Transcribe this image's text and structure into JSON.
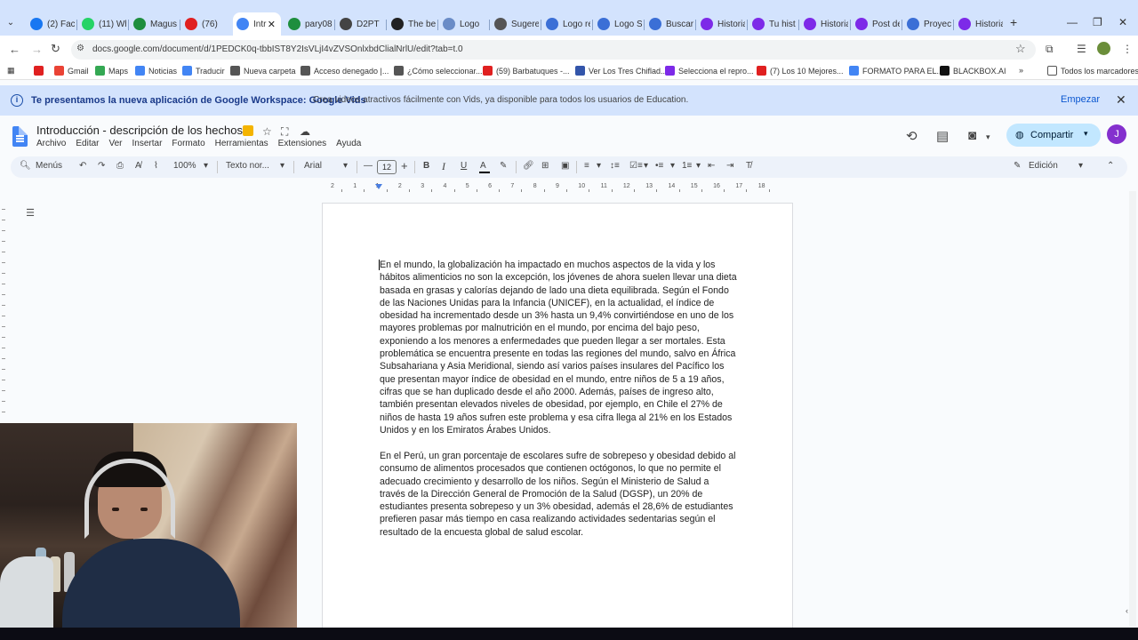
{
  "browser": {
    "tabs": [
      {
        "label": "(2) Face",
        "color": "#1877f2"
      },
      {
        "label": "(11) Wh",
        "color": "#25d366"
      },
      {
        "label": "Magus",
        "color": "#1e8e3e"
      },
      {
        "label": "(76)",
        "color": "#e02020"
      },
      {
        "label": "Intr",
        "color": "#4285f4",
        "active": true
      },
      {
        "label": "pary08",
        "color": "#1e8e3e"
      },
      {
        "label": "D2PT",
        "color": "#444444"
      },
      {
        "label": "The be",
        "color": "#222222"
      },
      {
        "label": "Logo",
        "color": "#6a8cc7"
      },
      {
        "label": "Sugere",
        "color": "#555555"
      },
      {
        "label": "Logo re",
        "color": "#3b6fd6"
      },
      {
        "label": "Logo S",
        "color": "#3b6fd6"
      },
      {
        "label": "Buscar",
        "color": "#3b6fd6"
      },
      {
        "label": "Historia",
        "color": "#7d2ae8"
      },
      {
        "label": "Tu hist",
        "color": "#7d2ae8"
      },
      {
        "label": "Historia",
        "color": "#7d2ae8"
      },
      {
        "label": "Post de",
        "color": "#7d2ae8"
      },
      {
        "label": "Proyect",
        "color": "#3b6fd6"
      },
      {
        "label": "Historia",
        "color": "#7d2ae8"
      }
    ],
    "url": "docs.google.com/document/d/1PEDCK0q-tbbIST8Y2IsVLjI4vZVSOnlxbdClialNrlU/edit?tab=t.0",
    "bookmarks": [
      {
        "label": "Gmail",
        "color": "#ea4335"
      },
      {
        "label": "Maps",
        "color": "#34a853"
      },
      {
        "label": "Noticias",
        "color": "#4285f4"
      },
      {
        "label": "Traducir",
        "color": "#4285f4"
      },
      {
        "label": "Nueva carpeta",
        "color": "#555555"
      },
      {
        "label": "Acceso denegado |...",
        "color": "#555555"
      },
      {
        "label": "¿Cómo seleccionar...",
        "color": "#555555"
      },
      {
        "label": "(59) Barbatuques -...",
        "color": "#e02020"
      },
      {
        "label": "Ver Los Tres Chiflad...",
        "color": "#3355aa"
      },
      {
        "label": "Selecciona el repro...",
        "color": "#7d2ae8"
      },
      {
        "label": "(7) Los 10 Mejores...",
        "color": "#e02020"
      },
      {
        "label": "FORMATO PARA EL...",
        "color": "#4285f4"
      },
      {
        "label": "BLACKBOX.AI",
        "color": "#111111"
      }
    ],
    "bookmarks_all": "Todos los marcadores"
  },
  "banner": {
    "title": "Te presentamos la nueva aplicación de Google Workspace: Google Vids",
    "text": "Crea videos atractivos fácilmente con Vids, ya disponible para todos los usuarios de Education.",
    "button": "Empezar"
  },
  "doc": {
    "title": "Introducción - descripción de los hechos",
    "menu": [
      "Archivo",
      "Editar",
      "Ver",
      "Insertar",
      "Formato",
      "Herramientas",
      "Extensiones",
      "Ayuda"
    ],
    "share_label": "Compartir",
    "avatar_letter": "J"
  },
  "toolbar": {
    "search_label": "Menús",
    "zoom": "100%",
    "style": "Texto nor...",
    "font": "Arial",
    "font_size": "12",
    "mode": "Edición"
  },
  "ruler": {
    "labels": [
      "2",
      "1",
      "1",
      "2",
      "3",
      "4",
      "5",
      "6",
      "7",
      "8",
      "9",
      "10",
      "11",
      "12",
      "13",
      "14",
      "15",
      "16",
      "17",
      "18"
    ]
  },
  "content": {
    "paragraphs": [
      "En el mundo, la globalización ha impactado en muchos aspectos de la vida y los hábitos alimenticios no son la excepción, los jóvenes de ahora suelen llevar una dieta basada en grasas y calorías dejando de lado una dieta equilibrada. Según el Fondo de las Naciones Unidas para la Infancia (UNICEF), en la actualidad, el índice de obesidad ha incrementado desde un 3% hasta un 9,4% convirtiéndose en uno de los mayores problemas por malnutrición en el mundo, por encima del bajo peso, exponiendo a los menores a enfermedades que pueden llegar a ser mortales. Esta problemática se encuentra presente en todas las regiones del mundo, salvo en África Subsahariana y Asia Meridional, siendo así varios países insulares del Pacífico los que presentan mayor índice de obesidad en el mundo, entre niños de 5 a 19 años, cifras que se han duplicado desde el año 2000. Además, países de ingreso alto, también presentan elevados niveles de obesidad, por ejemplo, en Chile el 27% de niños de hasta 19 años sufren este problema y esa cifra llega al 21% en los Estados Unidos y en los Emiratos Árabes Unidos.",
      "En el Perú, un gran porcentaje de escolares sufre de sobrepeso y obesidad debido al consumo de alimentos procesados que contienen octógonos, lo que no permite el adecuado crecimiento y desarrollo de los niños. Según el Ministerio de Salud a través de la Dirección General de Promoción de la Salud (DGSP), un 20% de estudiantes presenta sobrepeso y un 3% obesidad, además el 28,6% de estudiantes prefieren pasar más tiempo en casa realizando actividades sedentarias según el resultado de la encuesta global de salud escolar."
    ]
  }
}
